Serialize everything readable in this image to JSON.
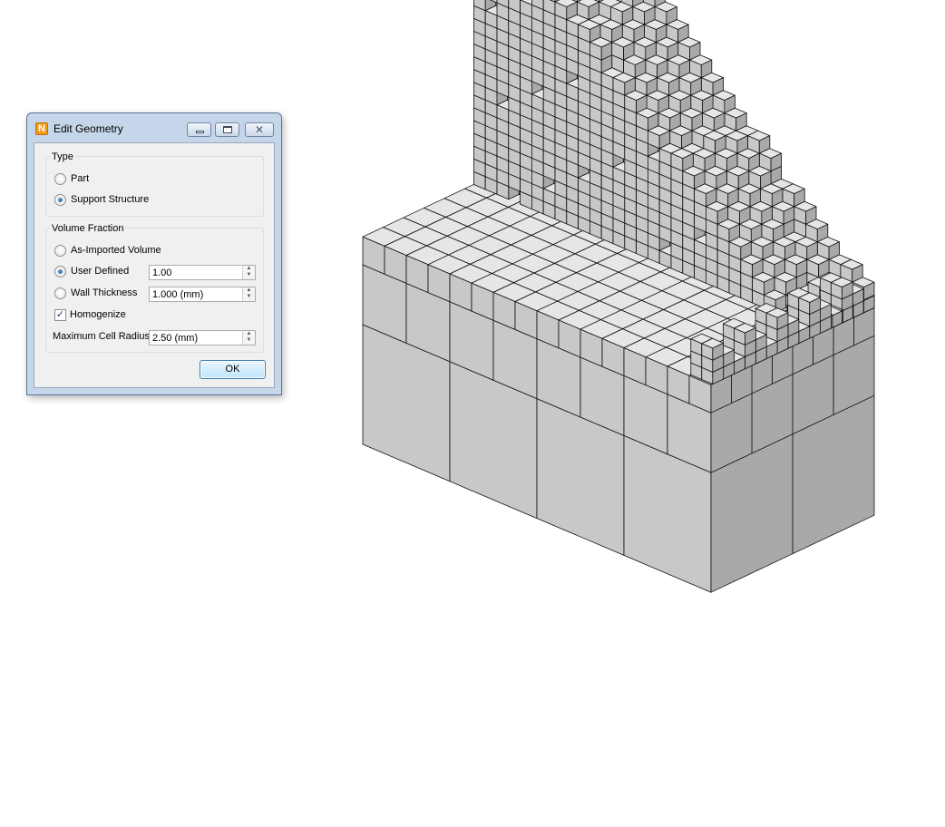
{
  "dialog": {
    "title": "Edit Geometry",
    "app_icon_letter": "N",
    "type_group": {
      "label": "Type",
      "options": [
        {
          "label": "Part",
          "checked": false
        },
        {
          "label": "Support Structure",
          "checked": true
        }
      ]
    },
    "volume_fraction_group": {
      "label": "Volume Fraction",
      "options": [
        {
          "label": "As-Imported Volume",
          "checked": false
        },
        {
          "label": "User Defined",
          "checked": true,
          "value": "1.00"
        },
        {
          "label": "Wall Thickness",
          "checked": false,
          "value": "1.000 (mm)"
        }
      ],
      "homogenize": {
        "label": "Homogenize",
        "checked": true
      },
      "max_cell_radius": {
        "label": "Maximum Cell Radius",
        "value": "2.50 (mm)"
      }
    },
    "ok_label": "OK"
  },
  "viewport": {
    "content": "octree-voxel-mesh",
    "colors": {
      "top_face": "#e6e6e6",
      "left_face": "#c8c8c8",
      "right_face": "#a9a9a9",
      "edge": "#111111",
      "accent_orange": "#f39b1d",
      "selected_blue": "#1b4f86"
    }
  }
}
